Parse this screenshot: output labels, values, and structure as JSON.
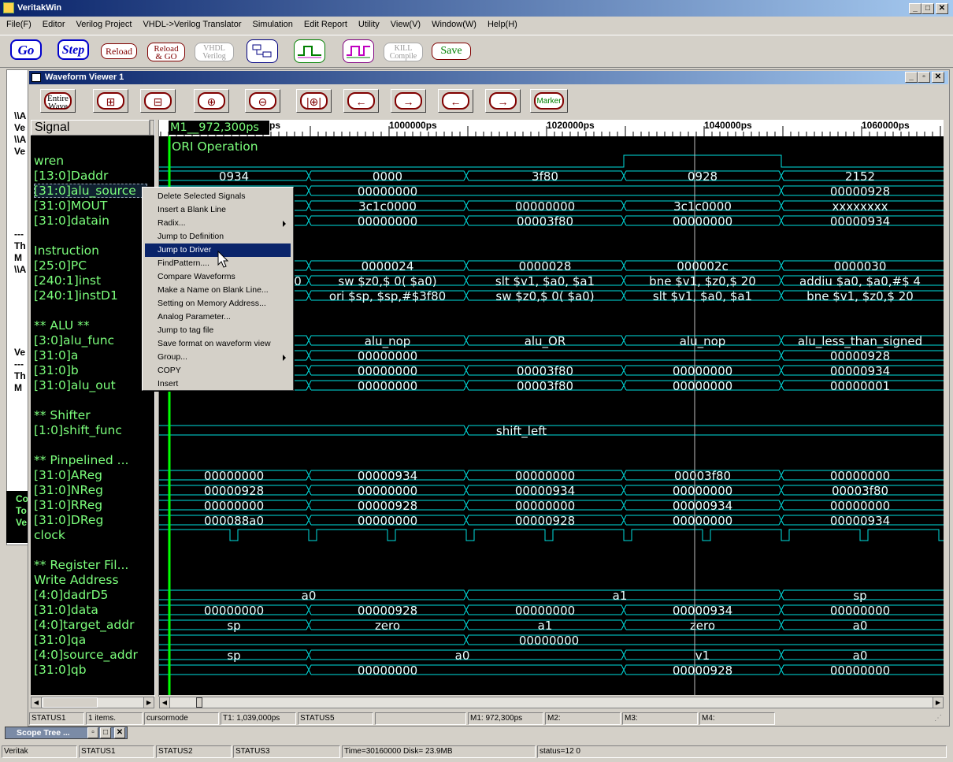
{
  "app": {
    "title": "VeritakWin",
    "menu": [
      "File(F)",
      "Editor",
      "Verilog Project",
      "VHDL->Verilog Translator",
      "Simulation",
      "Edit Report",
      "Utility",
      "View(V)",
      "Window(W)",
      "Help(H)"
    ],
    "toolbar": {
      "go": "Go",
      "step": "Step",
      "reload": "Reload",
      "reload_go_1": "Reload",
      "reload_go_2": "& GO",
      "vhdl_1": "VHDL",
      "vhdl_2": "Verilog",
      "kill_1": "KILL",
      "kill_2": "Compile",
      "save": "Save"
    }
  },
  "waveform": {
    "title": "Waveform Viewer 1",
    "toolbar": {
      "entire_1": "Entire",
      "entire_2": "Wave",
      "marker": "Marker"
    },
    "signal_header": "Signal",
    "cursor_label": "M1__972,300ps",
    "timescale": {
      "partial": "ps",
      "t1": "1000000ps",
      "t2": "1020000ps",
      "t3": "1040000ps",
      "t4": "1060000ps"
    },
    "group_label": "ORI Operation",
    "signals": [
      {
        "row": 1,
        "name": "wren"
      },
      {
        "row": 2,
        "name": "[13:0]Daddr"
      },
      {
        "row": 3,
        "name": "[31:0]alu_source"
      },
      {
        "row": 4,
        "name": "[31:0]MOUT"
      },
      {
        "row": 5,
        "name": "[31:0]datain"
      },
      {
        "row": 7,
        "name": "Instruction"
      },
      {
        "row": 8,
        "name": "[25:0]PC"
      },
      {
        "row": 9,
        "name": "[240:1]inst"
      },
      {
        "row": 10,
        "name": "[240:1]instD1"
      },
      {
        "row": 12,
        "name": "** ALU **"
      },
      {
        "row": 13,
        "name": "[3:0]alu_func"
      },
      {
        "row": 14,
        "name": "[31:0]a"
      },
      {
        "row": 15,
        "name": "[31:0]b"
      },
      {
        "row": 16,
        "name": "[31:0]alu_out"
      },
      {
        "row": 18,
        "name": "** Shifter"
      },
      {
        "row": 19,
        "name": "[1:0]shift_func"
      },
      {
        "row": 21,
        "name": "** Pinpelined ..."
      },
      {
        "row": 22,
        "name": "[31:0]AReg"
      },
      {
        "row": 23,
        "name": "[31:0]NReg"
      },
      {
        "row": 24,
        "name": "[31:0]RReg"
      },
      {
        "row": 25,
        "name": "[31:0]DReg"
      },
      {
        "row": 26,
        "name": "clock"
      },
      {
        "row": 28,
        "name": "** Register Fil..."
      },
      {
        "row": 29,
        "name": " Write Address"
      },
      {
        "row": 30,
        "name": "[4:0]dadrD5"
      },
      {
        "row": 31,
        "name": "[31:0]data"
      },
      {
        "row": 32,
        "name": "[4:0]target_addr"
      },
      {
        "row": 33,
        "name": "[31:0]qa"
      },
      {
        "row": 34,
        "name": "[4:0]source_addr"
      },
      {
        "row": 35,
        "name": "[31:0]qb"
      }
    ],
    "buses": [
      {
        "row": 2,
        "segs": [
          [
            "0934",
            0
          ],
          [
            "0000",
            1
          ],
          [
            "3f80",
            2
          ],
          [
            "0928",
            3
          ],
          [
            "2152",
            4
          ]
        ]
      },
      {
        "row": 3,
        "segs": [
          [
            "00000000",
            1
          ],
          [
            "00000928",
            4
          ]
        ]
      },
      {
        "row": 4,
        "segs": [
          [
            "3c1c0000",
            1
          ],
          [
            "00000000",
            2
          ],
          [
            "3c1c0000",
            3
          ],
          [
            "xxxxxxxx",
            4
          ]
        ]
      },
      {
        "row": 5,
        "segs": [
          [
            "00000000",
            1
          ],
          [
            "00003f80",
            2
          ],
          [
            "00000000",
            3
          ],
          [
            "00000934",
            4
          ]
        ]
      },
      {
        "row": 8,
        "segs": [
          [
            "0000024",
            1
          ],
          [
            "0000028",
            2
          ],
          [
            "000002c",
            3
          ],
          [
            "0000030",
            4
          ]
        ]
      },
      {
        "row": 9,
        "segs": [
          [
            "0",
            0
          ],
          [
            "sw  $z0,$   0( $a0)",
            1
          ],
          [
            "slt  $v1, $a0, $a1",
            2
          ],
          [
            "bne  $v1, $z0,$     20",
            3
          ],
          [
            "addiu  $a0, $a0,#$   4",
            4
          ]
        ]
      },
      {
        "row": 10,
        "segs": [
          [
            "ori  $sp, $sp,#$3f80",
            1
          ],
          [
            "sw  $z0,$   0( $a0)",
            2
          ],
          [
            "slt  $v1, $a0, $a1",
            3
          ],
          [
            "bne  $v1, $z0,$     20",
            4
          ]
        ]
      },
      {
        "row": 13,
        "segs": [
          [
            "alu_nop",
            1
          ],
          [
            "alu_OR",
            2
          ],
          [
            "alu_nop",
            3
          ],
          [
            "alu_less_than_signed",
            4
          ]
        ]
      },
      {
        "row": 14,
        "segs": [
          [
            "00000000",
            1
          ],
          [
            "00000928",
            4
          ]
        ]
      },
      {
        "row": 15,
        "segs": [
          [
            "00000000",
            1
          ],
          [
            "00003f80",
            2
          ],
          [
            "00000000",
            3
          ],
          [
            "00000934",
            4
          ]
        ]
      },
      {
        "row": 16,
        "segs": [
          [
            "00000000",
            1
          ],
          [
            "00003f80",
            2
          ],
          [
            "00000000",
            3
          ],
          [
            "00000001",
            4
          ]
        ]
      },
      {
        "row": 19,
        "segs": [
          [
            "shift_left",
            2
          ]
        ]
      },
      {
        "row": 22,
        "segs": [
          [
            "00000000",
            0
          ],
          [
            "00000934",
            1
          ],
          [
            "00000000",
            2
          ],
          [
            "00003f80",
            3
          ],
          [
            "00000000",
            4
          ]
        ]
      },
      {
        "row": 23,
        "segs": [
          [
            "00000928",
            0
          ],
          [
            "00000000",
            1
          ],
          [
            "00000934",
            2
          ],
          [
            "00000000",
            3
          ],
          [
            "00003f80",
            4
          ]
        ]
      },
      {
        "row": 24,
        "segs": [
          [
            "00000000",
            0
          ],
          [
            "00000928",
            1
          ],
          [
            "00000000",
            2
          ],
          [
            "00000934",
            3
          ],
          [
            "00000000",
            4
          ]
        ]
      },
      {
        "row": 25,
        "segs": [
          [
            "000088a0",
            0
          ],
          [
            "00000000",
            1
          ],
          [
            "00000928",
            2
          ],
          [
            "00000000",
            3
          ],
          [
            "00000934",
            4
          ]
        ]
      },
      {
        "row": 30,
        "segs": [
          [
            "a0",
            0.5
          ],
          [
            "a1",
            2.5
          ],
          [
            "sp",
            4
          ]
        ]
      },
      {
        "row": 31,
        "segs": [
          [
            "00000000",
            0
          ],
          [
            "00000928",
            1
          ],
          [
            "00000000",
            2
          ],
          [
            "00000934",
            3
          ],
          [
            "00000000",
            4
          ]
        ]
      },
      {
        "row": 32,
        "segs": [
          [
            "sp",
            0
          ],
          [
            "zero",
            1
          ],
          [
            "a1",
            2
          ],
          [
            "zero",
            3
          ],
          [
            "a0",
            4
          ]
        ]
      },
      {
        "row": 33,
        "segs": [
          [
            "00000000",
            2
          ]
        ]
      },
      {
        "row": 34,
        "segs": [
          [
            "sp",
            0
          ],
          [
            "a0",
            1.5
          ],
          [
            "v1",
            3
          ],
          [
            "a0",
            4
          ]
        ]
      },
      {
        "row": 35,
        "segs": [
          [
            "00000000",
            1
          ],
          [
            "00000928",
            3
          ],
          [
            "00000000",
            4
          ]
        ]
      }
    ],
    "context_menu": [
      "Delete Selected Signals",
      "Insert a Blank Line",
      "Radix...",
      "Jump to Definition",
      "Jump to Driver",
      "FindPattern....",
      "Compare Waveforms",
      "Make a Name on Blank Line...",
      "Setting on Memory Address...",
      "Analog Parameter...",
      "Jump to tag file",
      "Save format on waveform view",
      "Group...",
      "COPY",
      "Insert"
    ],
    "status": {
      "s1": "STATUS1",
      "items": "1 items.",
      "mode": "cursormode",
      "t1": "T1: 1,039,000ps",
      "s5": "STATUS5",
      "m1": "M1: 972,300ps",
      "m2": "M2:",
      "m3": "M3:",
      "m4": "M4:"
    }
  },
  "background_text": [
    "\\\\A",
    "Ve",
    "\\\\A",
    "Ve",
    "---",
    "Th",
    "M",
    "\\\\A",
    "Ve",
    "---",
    "Th",
    "M"
  ],
  "console": [
    "Co",
    "To",
    "Ve"
  ],
  "scope_tree": "Scope Tree ...",
  "statusbar": {
    "app": "Veritak",
    "s1": "STATUS1",
    "s2": "STATUS2",
    "s3": "STATUS3",
    "time": "Time=30160000 Disk= 23.9MB",
    "status": "status=12 0"
  },
  "colors": {
    "wave": "#00e0e0",
    "signal": "#7cff7c",
    "cursor": "#00ff00",
    "highlight": "#0a246a"
  }
}
